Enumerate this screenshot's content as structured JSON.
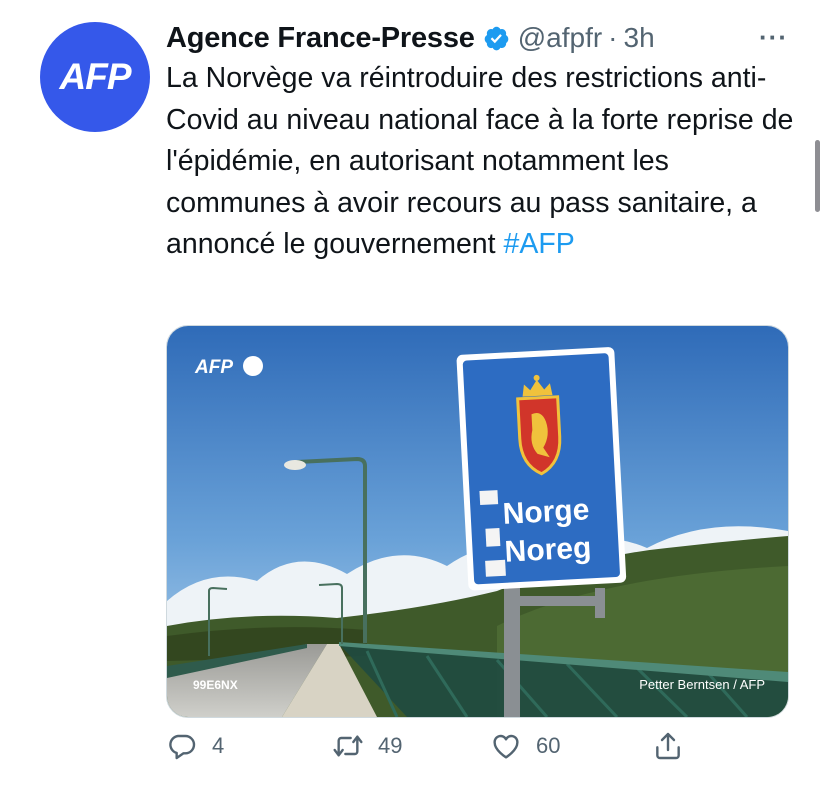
{
  "tweet": {
    "avatar_text": "AFP",
    "display_name": "Agence France-Presse",
    "handle": "@afpfr",
    "separator": "·",
    "time": "3h",
    "more_label": "···",
    "text_before": "La Norvège va réintroduire des restrictions anti-Covid au niveau national face à la forte reprise de l'épidémie, en autorisant notamment les communes à avoir recours au pass sanitaire, a annoncé le gouvernement ",
    "hashtag": "#AFP"
  },
  "media": {
    "watermark_logo": "AFP",
    "sign_line1": "Norge",
    "sign_line2": "Noreg",
    "photo_id": "99E6NX",
    "credit": "Petter Berntsen / AFP"
  },
  "actions": {
    "reply_count": "4",
    "retweet_count": "49",
    "like_count": "60"
  },
  "colors": {
    "brand": "#3558ea",
    "link": "#1d9bf0",
    "muted": "#536471"
  }
}
